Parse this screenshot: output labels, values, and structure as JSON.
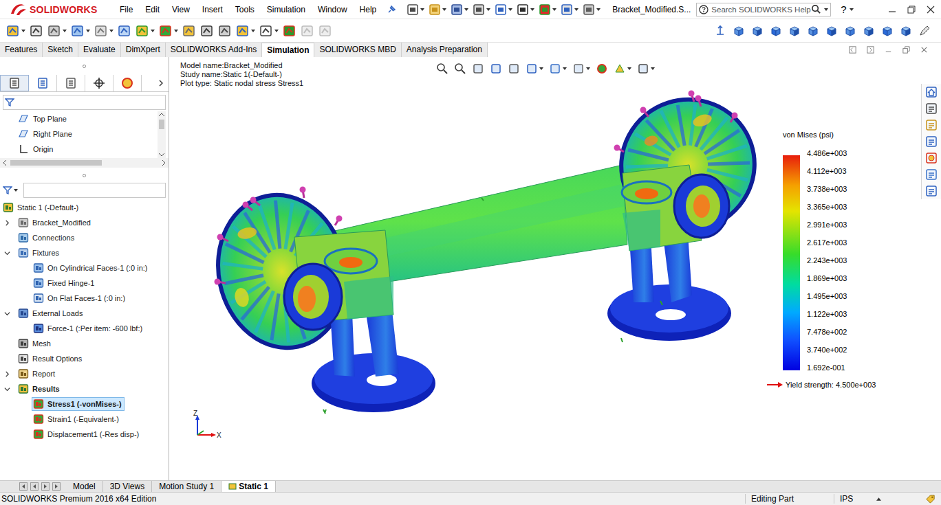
{
  "window": {
    "title": "Bracket_Modified.S..."
  },
  "logo": {
    "text": "SOLIDWORKS"
  },
  "menu": [
    "File",
    "Edit",
    "View",
    "Insert",
    "Tools",
    "Simulation",
    "Window",
    "Help"
  ],
  "search": {
    "placeholder": "Search SOLIDWORKS Help"
  },
  "help": "?",
  "ribbon_tabs": [
    {
      "label": "Features",
      "selected": false
    },
    {
      "label": "Sketch",
      "selected": false
    },
    {
      "label": "Evaluate",
      "selected": false
    },
    {
      "label": "DimXpert",
      "selected": false
    },
    {
      "label": "SOLIDWORKS Add-Ins",
      "selected": false
    },
    {
      "label": "Simulation",
      "selected": true
    },
    {
      "label": "SOLIDWORKS MBD",
      "selected": false
    },
    {
      "label": "Analysis Preparation",
      "selected": false
    }
  ],
  "feature_tree": [
    {
      "label": "Top Plane",
      "kind": "plane"
    },
    {
      "label": "Right Plane",
      "kind": "plane"
    },
    {
      "label": "Origin",
      "kind": "origin"
    }
  ],
  "study_tree": {
    "label": "Static 1 (-Default-)",
    "kind": "study",
    "selected": false,
    "bold": false,
    "children": [
      {
        "label": "Bracket_Modified",
        "kind": "part",
        "expanded": false,
        "selected": false,
        "bold": false
      },
      {
        "label": "Connections",
        "kind": "connections",
        "selected": false,
        "bold": false
      },
      {
        "label": "Fixtures",
        "kind": "fixtures",
        "expanded": true,
        "selected": false,
        "bold": false,
        "children": [
          {
            "label": "On Cylindrical Faces-1 (:0 in:)",
            "kind": "fixture-cyl",
            "selected": false,
            "bold": false
          },
          {
            "label": "Fixed Hinge-1",
            "kind": "fixture-cyl",
            "selected": false,
            "bold": false
          },
          {
            "label": "On Flat Faces-1 (:0 in:)",
            "kind": "fixture-flat",
            "selected": false,
            "bold": false
          }
        ]
      },
      {
        "label": "External Loads",
        "kind": "loads",
        "expanded": true,
        "selected": false,
        "bold": false,
        "children": [
          {
            "label": "Force-1 (:Per item: -600 lbf:)",
            "kind": "force",
            "selected": false,
            "bold": false
          }
        ]
      },
      {
        "label": "Mesh",
        "kind": "mesh",
        "selected": false,
        "bold": false
      },
      {
        "label": "Result Options",
        "kind": "options",
        "selected": false,
        "bold": false
      },
      {
        "label": "Report",
        "kind": "report",
        "expanded": false,
        "selected": false,
        "bold": false
      },
      {
        "label": "Results",
        "kind": "results",
        "expanded": true,
        "selected": false,
        "bold": true,
        "children": [
          {
            "label": "Stress1 (-vonMises-)",
            "kind": "plot",
            "selected": true,
            "bold": true
          },
          {
            "label": "Strain1 (-Equivalent-)",
            "kind": "plot",
            "selected": false,
            "bold": false
          },
          {
            "label": "Displacement1 (-Res disp-)",
            "kind": "plot",
            "selected": false,
            "bold": false
          }
        ]
      }
    ]
  },
  "graphics": {
    "header": [
      "Model name:Bracket_Modified",
      "Study name:Static 1(-Default-)",
      "Plot type: Static nodal stress Stress1"
    ]
  },
  "legend": {
    "title": "von Mises (psi)",
    "ticks": [
      "4.486e+003",
      "4.112e+003",
      "3.738e+003",
      "3.365e+003",
      "2.991e+003",
      "2.617e+003",
      "2.243e+003",
      "1.869e+003",
      "1.495e+003",
      "1.122e+003",
      "7.478e+002",
      "3.740e+002",
      "1.692e-001"
    ],
    "yield": "Yield strength: 4.500e+003"
  },
  "triad": {
    "z": "Z",
    "x": "X"
  },
  "bottom_tabs": [
    {
      "label": "Model",
      "selected": false
    },
    {
      "label": "3D Views",
      "selected": false
    },
    {
      "label": "Motion Study 1",
      "selected": false
    },
    {
      "label": "Static 1",
      "selected": true
    }
  ],
  "status_bar": {
    "edition": "SOLIDWORKS Premium 2016 x64 Edition",
    "mode": "Editing Part",
    "units": "IPS"
  }
}
